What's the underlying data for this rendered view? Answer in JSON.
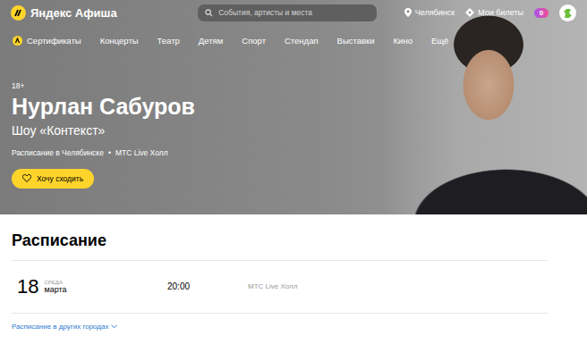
{
  "header": {
    "logo": "Яндекс Афиша",
    "search_placeholder": "События, артисты и места",
    "city": "Челябинск",
    "tickets": "Мои билеты",
    "badge": "0"
  },
  "nav": {
    "items": [
      {
        "label": "Сертификаты",
        "selected": false
      },
      {
        "label": "Концерты",
        "selected": false
      },
      {
        "label": "Театр",
        "selected": false
      },
      {
        "label": "Детям",
        "selected": false
      },
      {
        "label": "Спорт",
        "selected": false
      },
      {
        "label": "Стендап",
        "selected": false
      },
      {
        "label": "Выставки",
        "selected": false
      },
      {
        "label": "Кино",
        "selected": false
      },
      {
        "label": "Ещё",
        "selected": false
      }
    ]
  },
  "event": {
    "age": "18+",
    "title": "Нурлан Сабуров",
    "subtitle": "Шоу «Контекст»",
    "meta": [
      "Расписание в Челябинске",
      "МТС Live Холл"
    ],
    "separator": "•",
    "want_button": "Хочу сходить"
  },
  "schedule": {
    "title": "Расписание",
    "sessions": [
      {
        "day": "18",
        "weekday": "СРЕДА",
        "month": "марта",
        "time": "20:00",
        "venue": "МТС Live Холл"
      }
    ],
    "other_cities": "Расписание в других городах"
  }
}
